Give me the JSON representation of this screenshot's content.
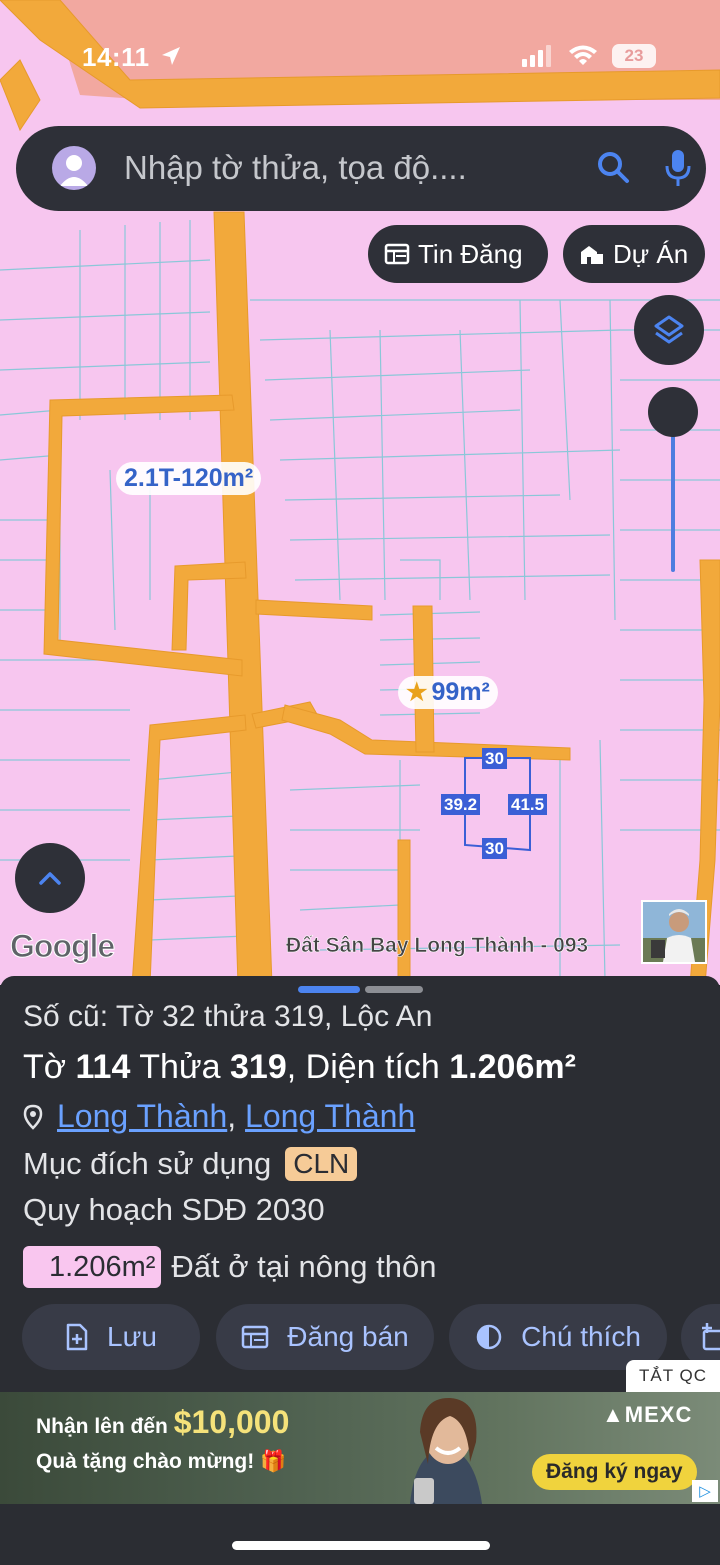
{
  "status_bar": {
    "time": "14:11",
    "battery": "23"
  },
  "search": {
    "placeholder": "Nhập tờ thửa, tọa độ...."
  },
  "chips": {
    "tin_dang": "Tin Đăng",
    "du_an": "Dự Án"
  },
  "map": {
    "price_label": "2.1T-120m²",
    "area_label": "99m²",
    "dims": {
      "top": "30",
      "left": "39.2",
      "right": "41.5",
      "bottom": "30"
    },
    "google": "Google",
    "watermark": "Đất Sân Bay Long Thành - 093"
  },
  "sheet": {
    "old_id": "Số cũ: Tờ 32 thửa 319, Lộc An",
    "main": {
      "to_label": "Tờ ",
      "to_value": "114",
      "thua_label": " Thửa ",
      "thua_value": "319",
      "area_label": ", Diện tích ",
      "area_value": "1.206m²"
    },
    "location": {
      "district": "Long Thành",
      "separator": ", ",
      "province": "Long Thành"
    },
    "purpose": {
      "label": "Mục đích sử dụng",
      "code": "CLN"
    },
    "plan": "Quy hoạch SDĐ 2030",
    "land": {
      "area": "1.206m²",
      "type": "Đất ở tại nông thôn"
    }
  },
  "actions": {
    "save": "Lưu",
    "post": "Đăng bán",
    "legend": "Chú thích"
  },
  "ad": {
    "close": "TẮT QC",
    "line1_prefix": "Nhận lên đến ",
    "line1_amount": "$10,000",
    "line2": "Quà tặng chào mừng! 🎁",
    "brand": "MEXC",
    "cta": "Đăng ký ngay"
  },
  "colors": {
    "map_bg": "#f7c6ef",
    "road": "#f2a93b",
    "accent": "#4c84f0",
    "panel": "#2b2d33"
  }
}
